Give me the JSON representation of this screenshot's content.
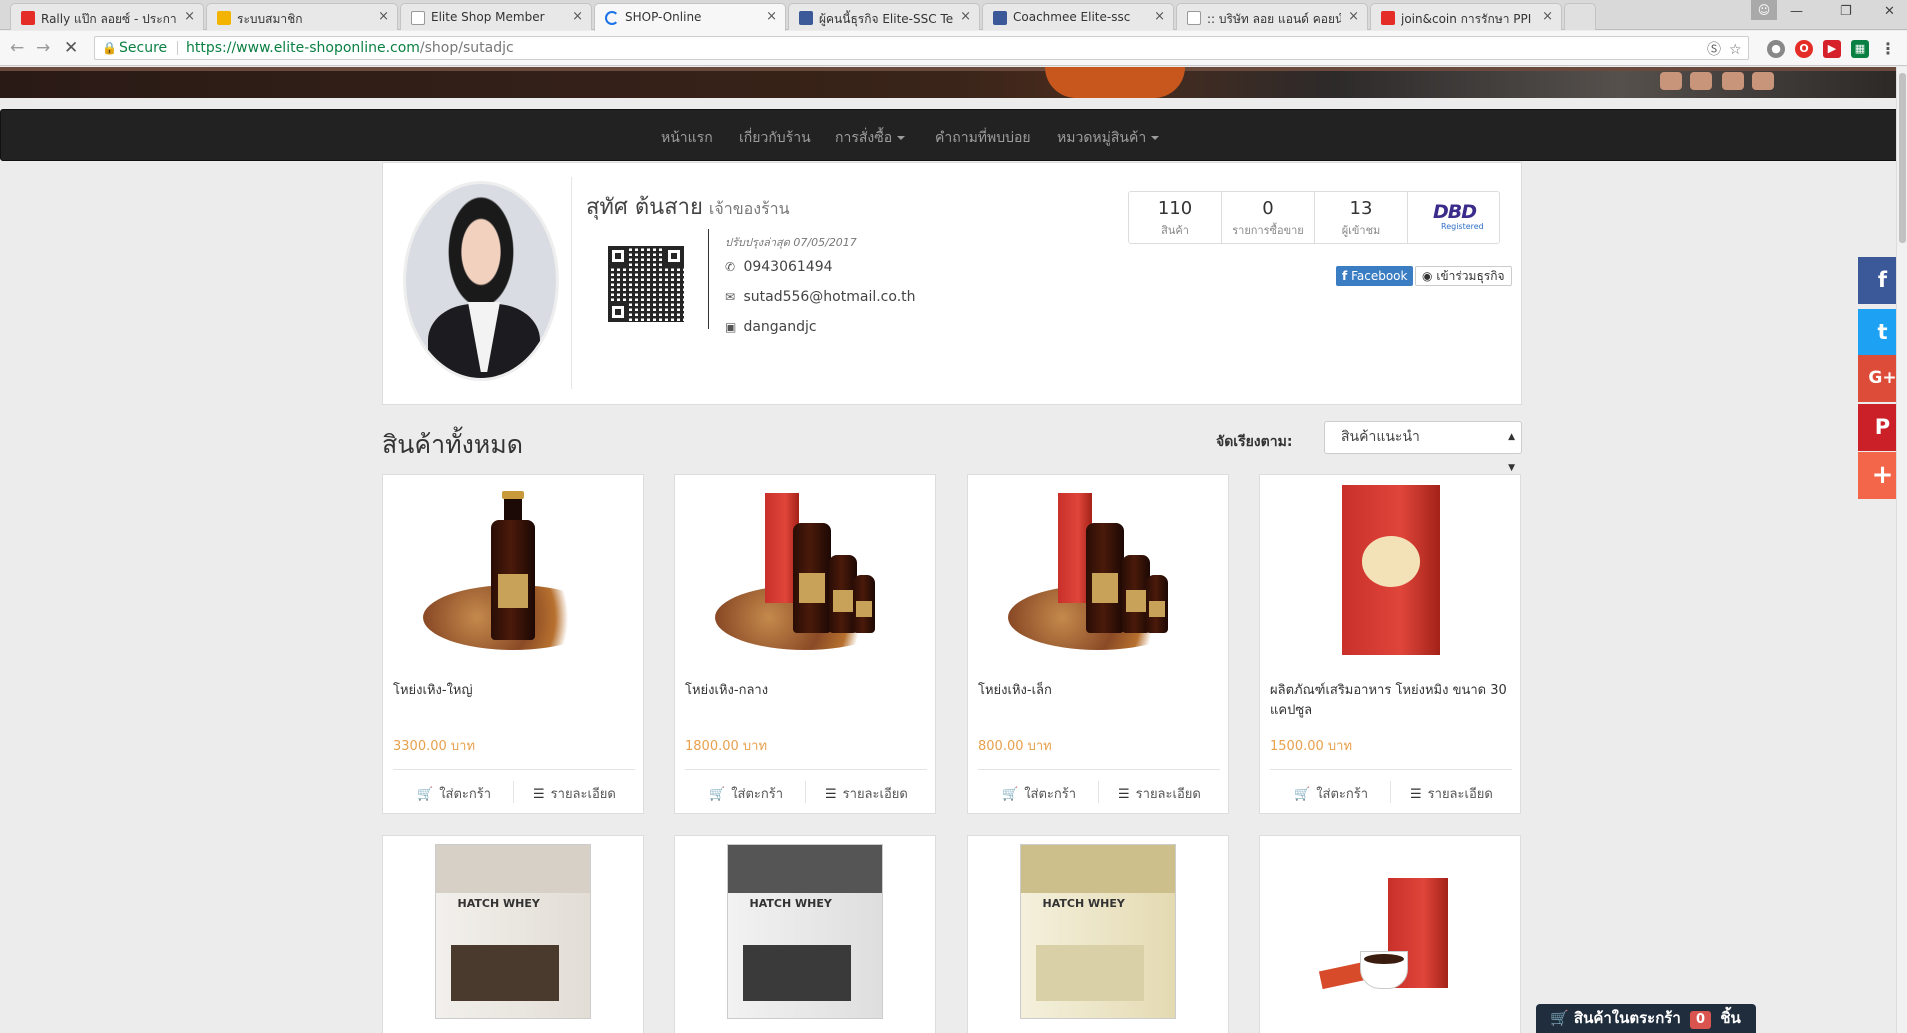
{
  "browser": {
    "tabs": [
      {
        "label": "Rally แป๊ก ลอยซ์ - ประกาศฯ",
        "icon_color": "#e52d27"
      },
      {
        "label": "ระบบสมาชิก",
        "icon_color": "#f2b400"
      },
      {
        "label": "Elite Shop Member",
        "icon_color": "#9e9e9e"
      },
      {
        "label": "SHOP-Online",
        "icon_color": "#1a73e8"
      },
      {
        "label": "ผู้คนนี้ธุรกิจ Elite-SSC Team",
        "icon_color": "#3b5998"
      },
      {
        "label": "Coachmee Elite-ssc",
        "icon_color": "#3b5998"
      },
      {
        "label": ":: บริษัท ลอย แอนด์ คอยน์ ดอ",
        "icon_color": "#9e9e9e"
      },
      {
        "label": "join&coin การรักษา PPI คือ",
        "icon_color": "#e52d27"
      }
    ],
    "close_glyph": "×",
    "secure_label": "Secure",
    "url_host": "https://www.elite-shoponline.com",
    "url_path": "/shop/sutadjc"
  },
  "nav": {
    "items": [
      "หน้าแรก",
      "เกี่ยวกับร้าน",
      "การสั่งซื้อ",
      "คำถามที่พบบ่อย",
      "หมวดหมู่สินค้า"
    ]
  },
  "profile": {
    "name": "สุทัศ ต้นสาย",
    "role": "เจ้าของร้าน",
    "updated": "ปรับปรุงล่าสุด 07/05/2017",
    "phone": "0943061494",
    "email": "sutad556@hotmail.co.th",
    "line": "dangandjc",
    "stats": [
      {
        "value": "110",
        "label": "สินค้า"
      },
      {
        "value": "0",
        "label": "รายการซื้อขาย"
      },
      {
        "value": "13",
        "label": "ผู้เข้าชม"
      }
    ],
    "dbd_logo": "DBD",
    "dbd_reg": "Registered",
    "facebook_label": "Facebook",
    "join_label": "เข้าร่วมธุรกิจ"
  },
  "listing": {
    "title": "สินค้าทั้งหมด",
    "sort_label": "จัดเรียงตาม:",
    "sort_value": "สินค้าแนะนำ",
    "add_to_cart": "ใส่ตะกร้า",
    "details": "รายละเอียด",
    "products": [
      {
        "name": "โหย่งเหิง-ใหญ่",
        "price": "3300.00 บาท"
      },
      {
        "name": "โหย่งเหิง-กลาง",
        "price": "1800.00 บาท"
      },
      {
        "name": "โหย่งเหิง-เล็ก",
        "price": "800.00 บาท"
      },
      {
        "name": "ผลิตภัณฑ์เสริมอาหาร โหย่งหมิง ขนาด 30 แคปซูล",
        "price": "1500.00 บาท"
      }
    ],
    "whey_titles": [
      "HATCH WHEY",
      "HATCH WHEY",
      "HATCH WHEY"
    ]
  },
  "share": [
    {
      "icon": "facebook-icon",
      "glyph": "f",
      "color": "#3b5998"
    },
    {
      "icon": "twitter-icon",
      "glyph": "t",
      "color": "#1da1f2"
    },
    {
      "icon": "google-plus-icon",
      "glyph": "G+",
      "color": "#dd4b39"
    },
    {
      "icon": "pinterest-icon",
      "glyph": "P",
      "color": "#cb2027"
    },
    {
      "icon": "more-share-icon",
      "glyph": "+",
      "color": "#f3664a"
    }
  ],
  "cart": {
    "label": "สินค้าในตระกร้า",
    "count": "0",
    "unit": "ชิ้น"
  }
}
